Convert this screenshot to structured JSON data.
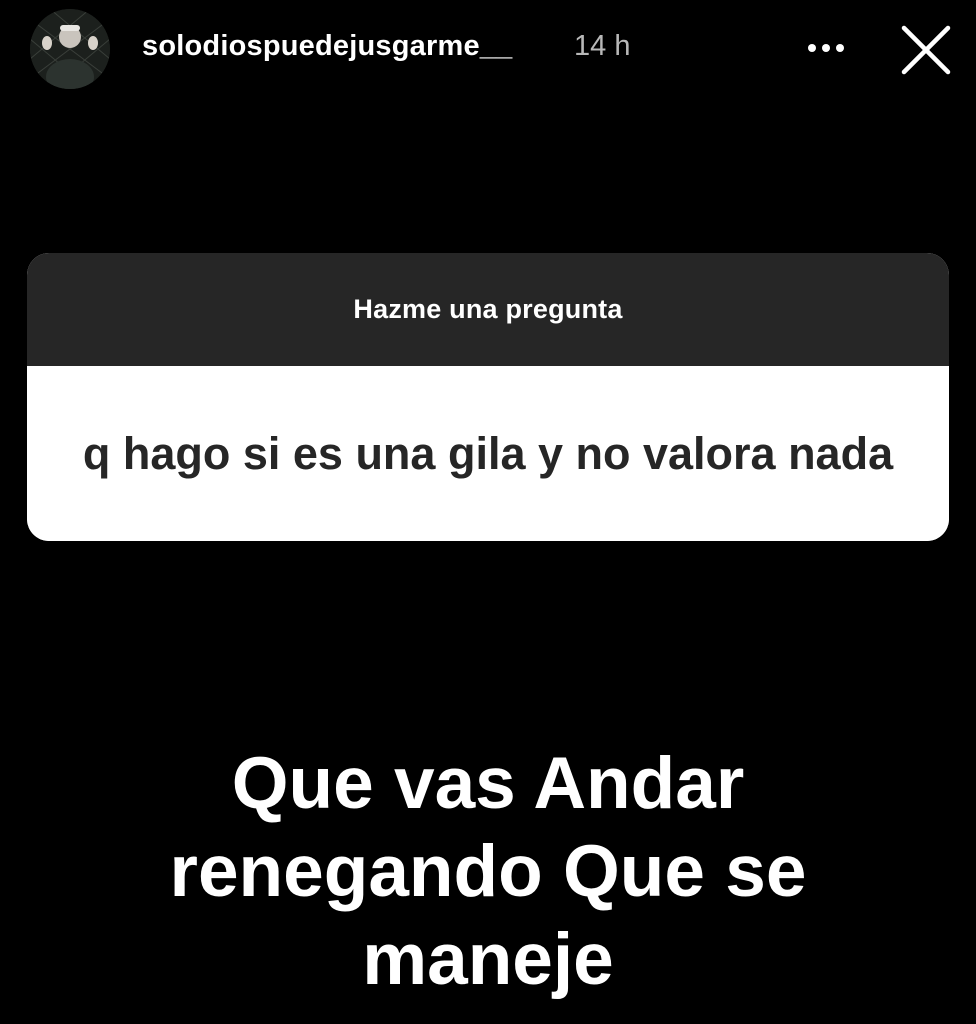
{
  "header": {
    "username": "solodiospuedejusgarme__",
    "time": "14 h",
    "more_icon": "more-horizontal-icon",
    "close_icon": "close-x-icon"
  },
  "question_sticker": {
    "title": "Hazme una pregunta",
    "question": "q hago si es una gila y no valora nada"
  },
  "answer": {
    "lines": [
      "Que vas Andar",
      "renegando Que se",
      "maneje"
    ]
  },
  "colors": {
    "background": "#000000",
    "card_header": "#262626",
    "card_body": "#ffffff",
    "question_text": "#262626",
    "time_text": "#b8b8b8"
  }
}
